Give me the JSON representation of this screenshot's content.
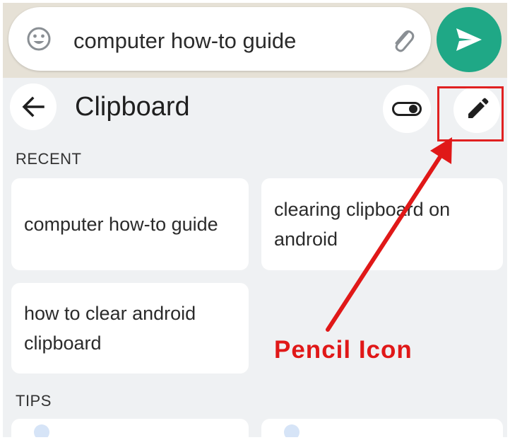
{
  "chat_bar": {
    "message_text": "computer how-to guide",
    "emoji_icon": "smiley-face-icon",
    "attach_icon": "paperclip-icon",
    "send_icon": "send-arrow-icon"
  },
  "clipboard": {
    "title": "Clipboard",
    "back_icon": "arrow-left-icon",
    "toggle_icon": "toggle-switch-icon",
    "edit_icon": "pencil-icon",
    "recent_label": "RECENT",
    "recent_items": [
      "computer how-to guide",
      "clearing clipboard on android",
      "how to clear android clipboard"
    ],
    "tips_label": "TIPS"
  },
  "annotation": {
    "label": "Pencil Icon",
    "color": "#e02020"
  },
  "colors": {
    "send_button": "#1fa886",
    "panel_bg": "#eff1f3",
    "chat_bg": "#e6e1d6"
  }
}
